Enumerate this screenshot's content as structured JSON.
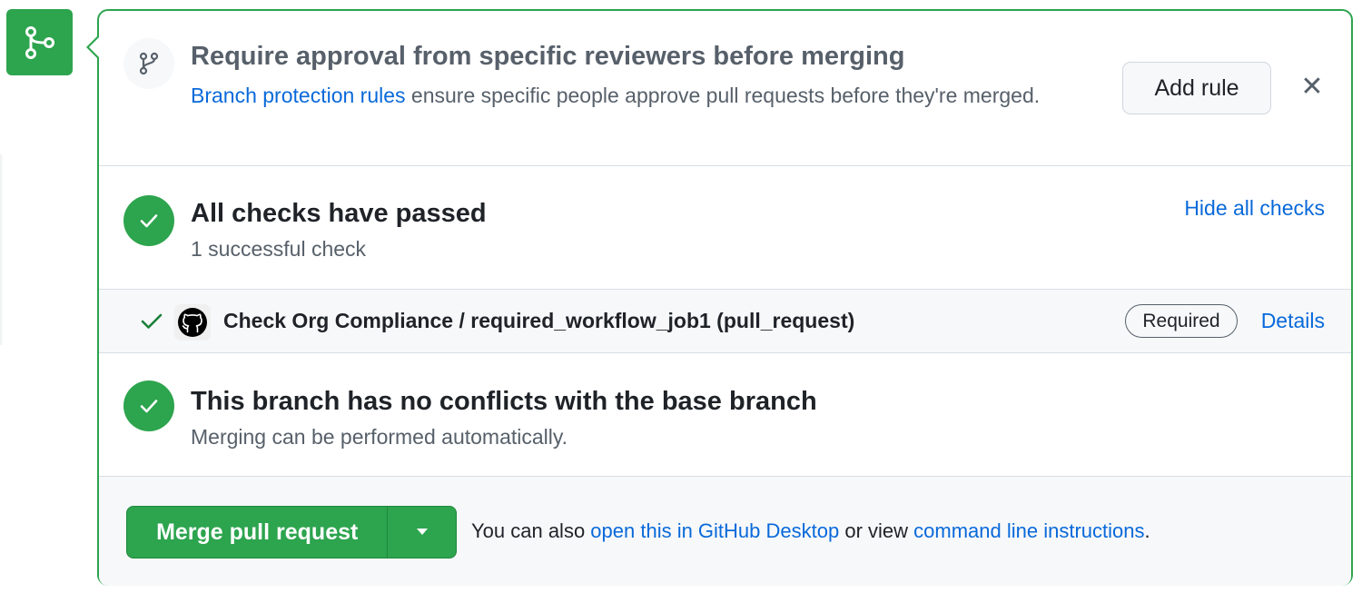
{
  "merge_icon": "git-merge-icon",
  "rule_prompt": {
    "icon": "git-branch-icon",
    "title": "Require approval from specific reviewers before merging",
    "link_text": "Branch protection rules",
    "description": " ensure specific people approve pull requests before they're merged.",
    "add_rule_label": "Add rule",
    "close_icon": "x-icon"
  },
  "checks": {
    "title": "All checks have passed",
    "subtitle": "1 successful check",
    "toggle_label": "Hide all checks",
    "items": [
      {
        "status_icon": "check-icon",
        "app_icon": "github-logo-icon",
        "name": "Check Org Compliance / required_workflow_job1 (pull_request)",
        "badge": "Required",
        "details_label": "Details"
      }
    ]
  },
  "conflicts": {
    "title": "This branch has no conflicts with the base branch",
    "subtitle": "Merging can be performed automatically."
  },
  "merge": {
    "button_label": "Merge pull request",
    "dropdown_icon": "triangle-down-icon",
    "text_prefix": "You can also ",
    "desktop_link": "open this in GitHub Desktop",
    "text_middle": " or view ",
    "cli_link": "command line instructions",
    "text_suffix": "."
  },
  "colors": {
    "success": "#2da44e",
    "link": "#0969da",
    "muted": "#57606a",
    "border": "#d8dee4",
    "subtle_bg": "#f6f8fa"
  }
}
